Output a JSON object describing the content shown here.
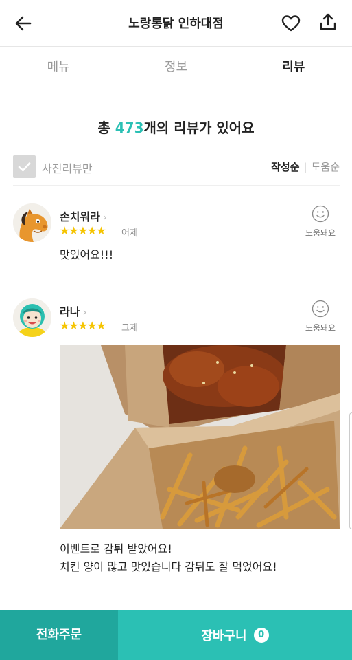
{
  "header": {
    "title": "노랑통닭 인하대점",
    "icons": {
      "back": "back-arrow-icon",
      "favorite": "heart-icon",
      "share": "share-icon"
    }
  },
  "tabs": [
    {
      "label": "메뉴",
      "active": false
    },
    {
      "label": "정보",
      "active": false
    },
    {
      "label": "리뷰",
      "active": true
    }
  ],
  "summary": {
    "prefix": "총 ",
    "count": "473",
    "suffix": "개의 리뷰가 있어요"
  },
  "filter": {
    "photo_only_label": "사진리뷰만",
    "photo_only_checked": false,
    "sort_options": [
      "작성순",
      "도움순"
    ],
    "sort_selected": "작성순"
  },
  "reviews": [
    {
      "nickname": "손치워라",
      "rating": 5,
      "stars": "★★★★★",
      "date": "어제",
      "helpful_label": "도움돼요",
      "text": "맛있어요!!!",
      "avatar": "horse-avatar"
    },
    {
      "nickname": "라나",
      "rating": 5,
      "stars": "★★★★★",
      "date": "그제",
      "helpful_label": "도움돼요",
      "text_lines": [
        "이벤트로 감튀 받았어요!",
        "치킨 양이 많고 맛있습니다 감튀도 잘 먹었어요!"
      ],
      "avatar": "girl-avatar",
      "has_photo": true
    }
  ],
  "bottom": {
    "call_label": "전화주문",
    "cart_label": "장바구니",
    "cart_count": "0"
  },
  "colors": {
    "accent": "#2bc0b4",
    "accent_dark": "#20a79d",
    "star": "#f5c400"
  }
}
